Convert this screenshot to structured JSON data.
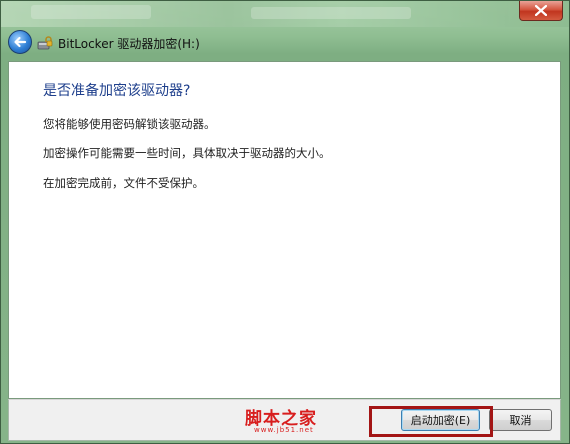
{
  "window": {
    "title": "BitLocker 驱动器加密(H:)"
  },
  "content": {
    "heading": "是否准备加密该驱动器?",
    "paragraphs": [
      "您将能够使用密码解锁该驱动器。",
      "加密操作可能需要一些时间，具体取决于驱动器的大小。",
      "在加密完成前，文件不受保护。"
    ]
  },
  "footer": {
    "watermark": "脚本之家",
    "watermark_sub": "www.jb51.net",
    "start_button_label": "启动加密(E)",
    "cancel_button_label": "取消"
  },
  "icons": {
    "back": "back-arrow-icon",
    "app": "bitlocker-icon",
    "close": "close-icon"
  },
  "colors": {
    "heading": "#1e3f8c",
    "highlight": "#a31515",
    "watermark": "#d81e1e"
  }
}
